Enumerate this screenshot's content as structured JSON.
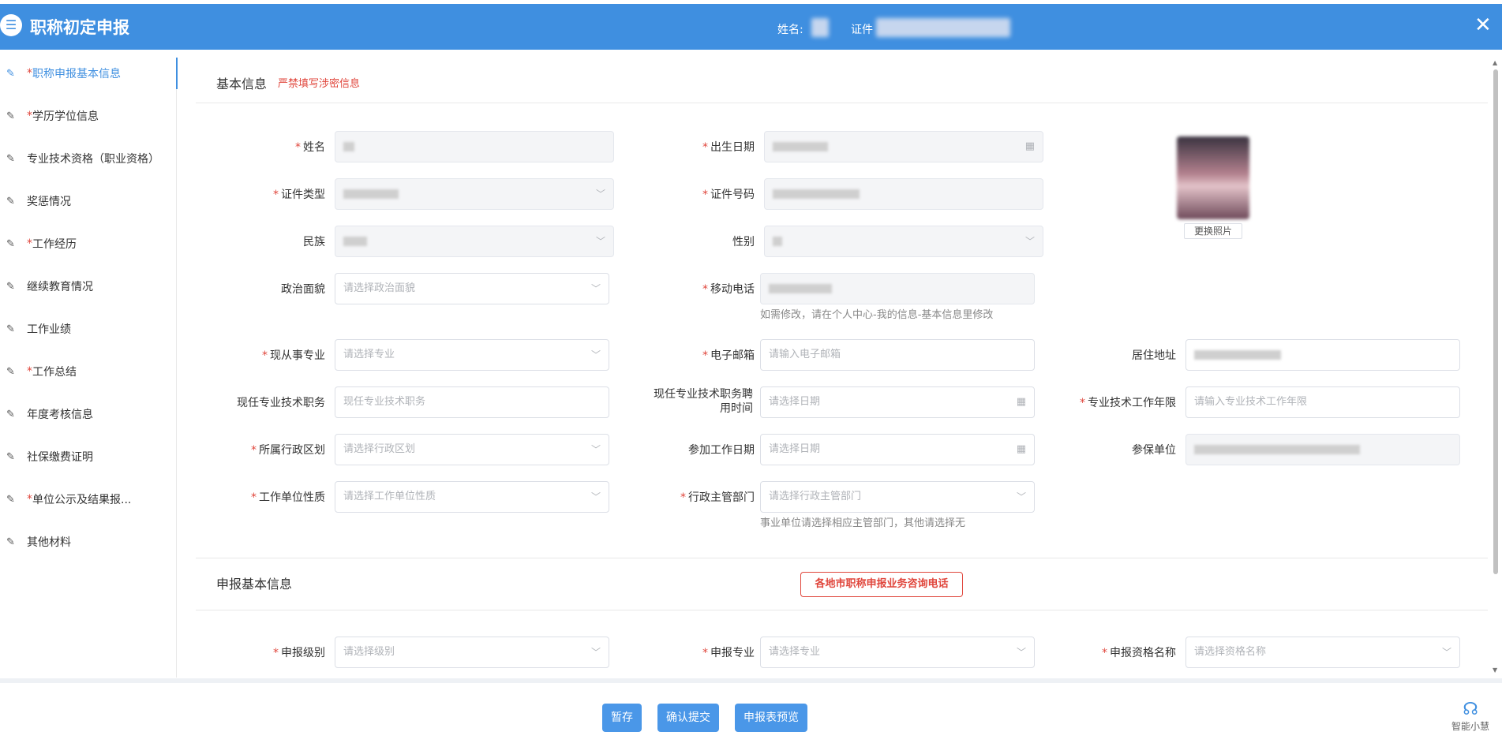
{
  "header": {
    "title": "职称初定申报",
    "name_label": "姓名:",
    "id_label": "证件",
    "close_icon": "close-icon"
  },
  "sidebar": {
    "items": [
      {
        "star": "* ",
        "label": "职称申报基本信息",
        "icon": "edit-icon",
        "active": true
      },
      {
        "star": "*",
        "label": "学历学位信息",
        "icon": "pencil-icon"
      },
      {
        "star": "",
        "label": "专业技术资格（职业资格）",
        "icon": "pencil-icon"
      },
      {
        "star": "",
        "label": "奖惩情况",
        "icon": "pencil-icon"
      },
      {
        "star": "*",
        "label": "工作经历",
        "icon": "pencil-icon"
      },
      {
        "star": "",
        "label": "继续教育情况",
        "icon": "pencil-icon"
      },
      {
        "star": "",
        "label": "工作业绩",
        "icon": "pencil-icon"
      },
      {
        "star": "*",
        "label": "工作总结",
        "icon": "pencil-icon"
      },
      {
        "star": "",
        "label": "年度考核信息",
        "icon": "pencil-icon"
      },
      {
        "star": "",
        "label": "社保缴费证明",
        "icon": "pencil-icon"
      },
      {
        "star": "*",
        "label": "单位公示及结果报...",
        "icon": "pencil-icon"
      },
      {
        "star": "",
        "label": "其他材料",
        "icon": "pencil-icon"
      }
    ]
  },
  "basic": {
    "title": "基本信息",
    "warning": "严禁填写涉密信息",
    "photo_button": "更换照片",
    "fields": {
      "name": {
        "label": "姓名",
        "required": "*"
      },
      "birth": {
        "label": "出生日期",
        "required": "*"
      },
      "id_type": {
        "label": "证件类型",
        "required": "*"
      },
      "id_no": {
        "label": "证件号码",
        "required": "*"
      },
      "ethnic": {
        "label": "民族",
        "required": ""
      },
      "gender": {
        "label": "性别",
        "required": ""
      },
      "political": {
        "label": "政治面貌",
        "required": "",
        "placeholder": "请选择政治面貌"
      },
      "mobile": {
        "label": "移动电话",
        "required": "*",
        "hint": "如需修改，请在个人中心-我的信息-基本信息里修改"
      },
      "major": {
        "label": "现从事专业",
        "required": "*",
        "placeholder": "请选择专业"
      },
      "email": {
        "label": "电子邮箱",
        "required": "*",
        "placeholder": "请输入电子邮箱"
      },
      "address": {
        "label": "居住地址",
        "required": ""
      },
      "post": {
        "label": "现任专业技术职务",
        "required": "",
        "placeholder": "现任专业技术职务"
      },
      "post_time": {
        "label": "现任专业技术职务聘用时间",
        "required": "",
        "placeholder": "请选择日期"
      },
      "years": {
        "label": "专业技术工作年限",
        "required": "*",
        "placeholder": "请输入专业技术工作年限"
      },
      "region": {
        "label": "所属行政区划",
        "required": "*",
        "placeholder": "请选择行政区划"
      },
      "work_date": {
        "label": "参加工作日期",
        "required": "",
        "placeholder": "请选择日期"
      },
      "insured_unit": {
        "label": "参保单位",
        "required": ""
      },
      "unit_nature": {
        "label": "工作单位性质",
        "required": "*",
        "placeholder": "请选择工作单位性质"
      },
      "admin_dept": {
        "label": "行政主管部门",
        "required": "*",
        "placeholder": "请选择行政主管部门",
        "hint": "事业单位请选择相应主管部门，其他请选择无"
      }
    }
  },
  "apply": {
    "title": "申报基本信息",
    "hotline": "各地市职称申报业务咨询电话",
    "fields": {
      "level": {
        "label": "申报级别",
        "required": "*",
        "placeholder": "请选择级别"
      },
      "major": {
        "label": "申报专业",
        "required": "*",
        "placeholder": "请选择专业"
      },
      "qualification": {
        "label": "申报资格名称",
        "required": "*",
        "placeholder": "请选择资格名称"
      }
    }
  },
  "footer": {
    "save": "暂存",
    "submit": "确认提交",
    "preview": "申报表预览",
    "assistant": "智能小慧"
  },
  "colors": {
    "primary": "#3f8fe0",
    "danger": "#e0463c"
  }
}
